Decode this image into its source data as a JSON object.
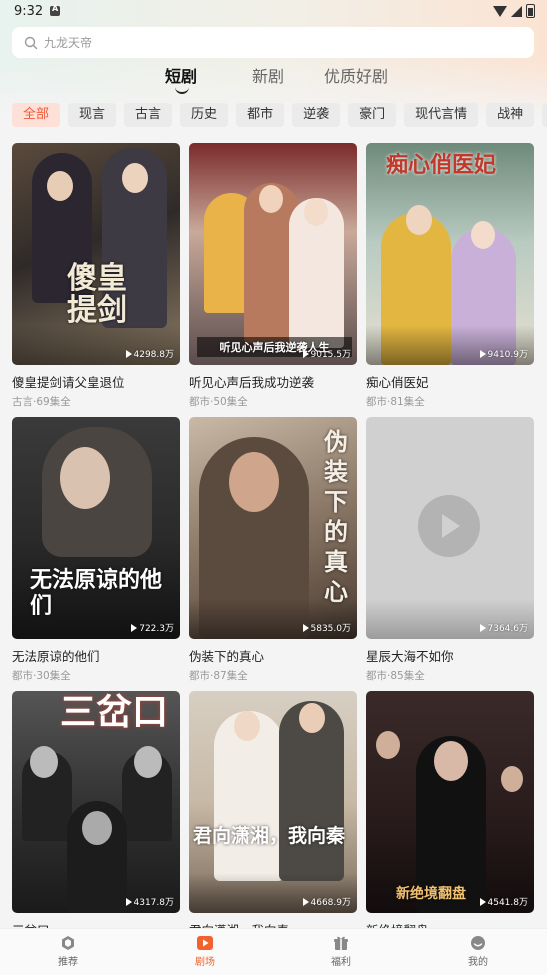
{
  "status": {
    "time": "9:32"
  },
  "search": {
    "placeholder": "九龙天帝"
  },
  "tabs": [
    {
      "label": "短剧",
      "active": true
    },
    {
      "label": "新剧",
      "active": false
    },
    {
      "label": "优质好剧",
      "active": false
    }
  ],
  "categories": [
    "全部",
    "现言",
    "古言",
    "历史",
    "都市",
    "逆袭",
    "豪门",
    "现代言情",
    "战神",
    "古"
  ],
  "dramas": [
    {
      "title": "傻皇提剑请父皇退位",
      "meta": "古言·69集全",
      "views": "4298.8万",
      "poster_text": "傻皇提剑"
    },
    {
      "title": "听见心声后我成功逆袭",
      "meta": "都市·50集全",
      "views": "9015.5万",
      "poster_text": "听见心声后我逆袭人生"
    },
    {
      "title": "痴心俏医妃",
      "meta": "都市·81集全",
      "views": "9410.9万",
      "poster_text": "痴心俏医妃"
    },
    {
      "title": "无法原谅的他们",
      "meta": "都市·30集全",
      "views": "722.3万",
      "poster_text": "无法原谅的他们"
    },
    {
      "title": "伪装下的真心",
      "meta": "都市·87集全",
      "views": "5835.0万",
      "poster_text": "伪装下的真心"
    },
    {
      "title": "星辰大海不如你",
      "meta": "都市·85集全",
      "views": "7364.6万",
      "poster_text": ""
    },
    {
      "title": "三岔口",
      "meta": "",
      "views": "4317.8万",
      "poster_text": "三岔口"
    },
    {
      "title": "君向潇湘，我向秦",
      "meta": "",
      "views": "4668.9万",
      "poster_text": "君向潇湘，我向秦"
    },
    {
      "title": "新绝境翻盘",
      "meta": "",
      "views": "4541.8万",
      "poster_text": "新绝境翻盘"
    }
  ],
  "nav": [
    {
      "label": "推荐",
      "icon": "recommend-icon",
      "active": false
    },
    {
      "label": "剧场",
      "icon": "theater-icon",
      "active": true
    },
    {
      "label": "福利",
      "icon": "gift-icon",
      "active": false
    },
    {
      "label": "我的",
      "icon": "profile-icon",
      "active": false
    }
  ],
  "colors": {
    "accent": "#f0632f",
    "active_chip_bg": "#fde0d8"
  }
}
